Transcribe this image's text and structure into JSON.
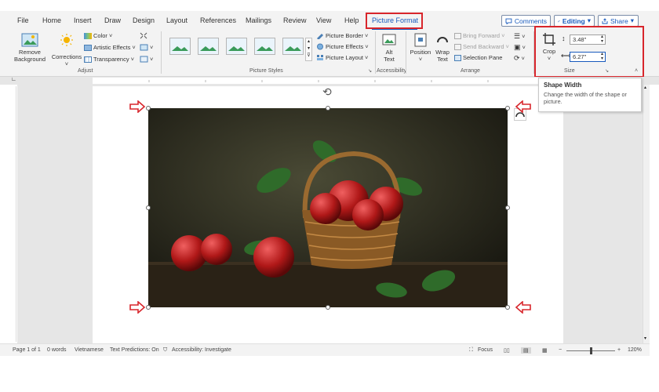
{
  "tabs": [
    "File",
    "Home",
    "Insert",
    "Draw",
    "Design",
    "Layout",
    "References",
    "Mailings",
    "Review",
    "View",
    "Help",
    "Picture Format"
  ],
  "active_tab": "Picture Format",
  "top_right": {
    "comments": "Comments",
    "editing": "Editing",
    "share": "Share"
  },
  "adjust": {
    "remove_background": [
      "Remove",
      "Background"
    ],
    "corrections": "Corrections",
    "color": "Color",
    "artistic_effects": "Artistic Effects",
    "transparency": "Transparency",
    "label": "Adjust"
  },
  "picture_styles": {
    "label": "Picture Styles",
    "border": "Picture Border",
    "effects": "Picture Effects",
    "layout": "Picture Layout"
  },
  "accessibility": {
    "alt_text": [
      "Alt",
      "Text"
    ],
    "label": "Accessibility"
  },
  "arrange": {
    "position": "Position",
    "wrap_text": [
      "Wrap",
      "Text"
    ],
    "bring_forward": "Bring Forward",
    "send_backward": "Send Backward",
    "selection_pane": "Selection Pane",
    "label": "Arrange"
  },
  "size": {
    "crop": "Crop",
    "height": "3.48\"",
    "width": "6.27\"",
    "label": "Size"
  },
  "tooltip": {
    "title": "Shape Width",
    "body": "Change the width of the shape or picture."
  },
  "status": {
    "page": "Page 1 of 1",
    "words": "0 words",
    "language": "Vietnamese",
    "text_predictions": "Text Predictions: On",
    "accessibility": "Accessibility: Investigate",
    "focus": "Focus",
    "zoom": "120%"
  },
  "colors": {
    "accent": "#185abd",
    "highlight": "#d8262c",
    "ribbon_bg": "#f3f3f3"
  }
}
